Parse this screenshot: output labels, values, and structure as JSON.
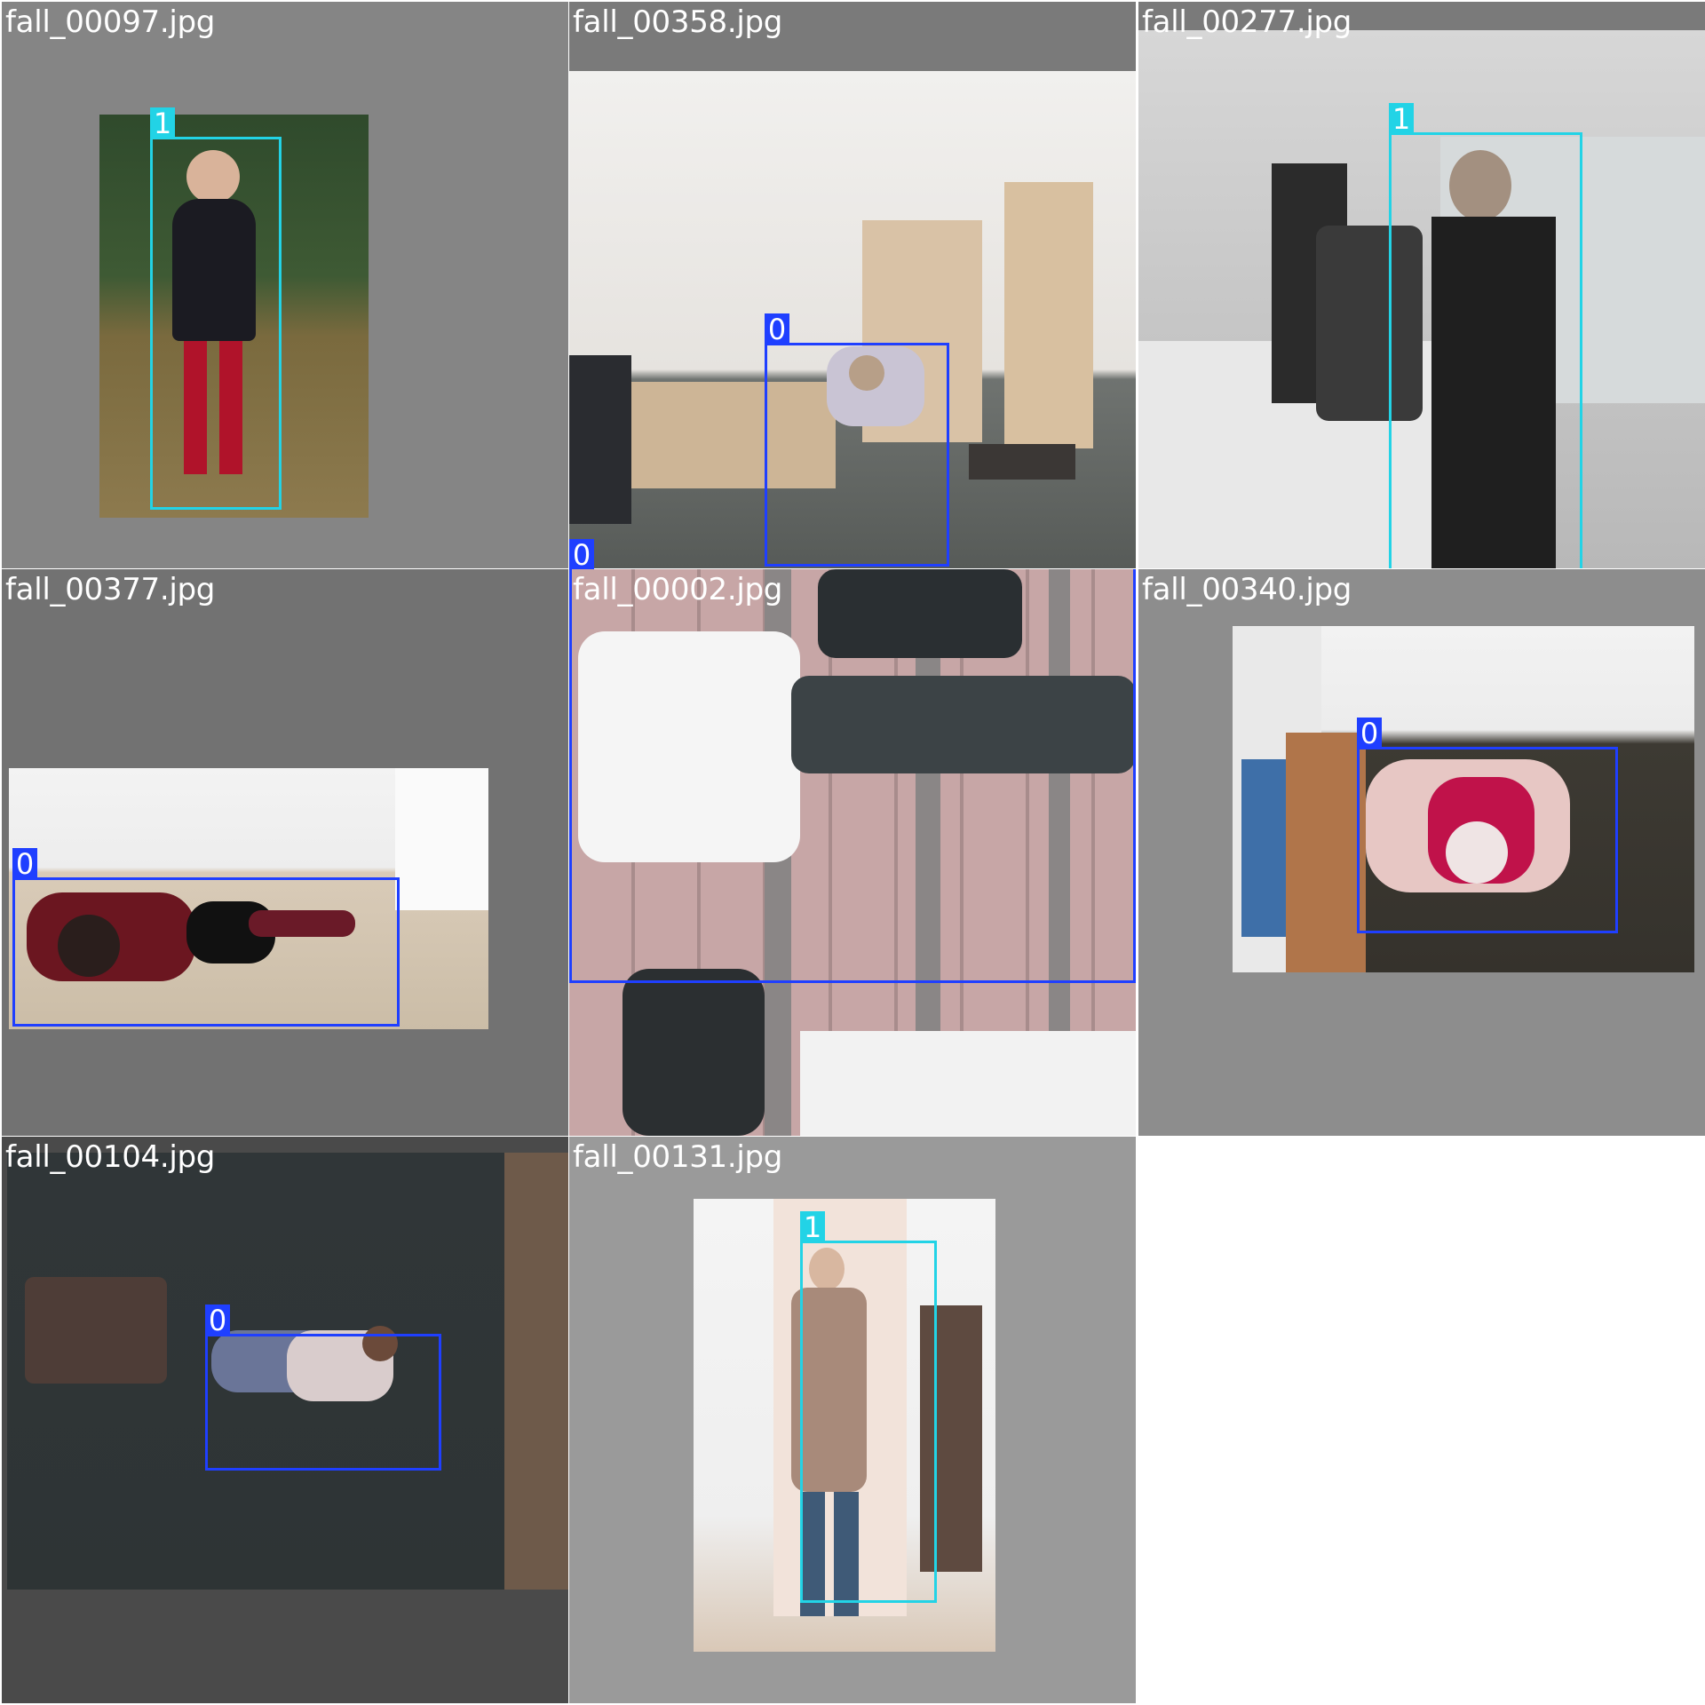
{
  "tiles": [
    {
      "filename": "fall_00097.jpg",
      "boxes": [
        {
          "cls": "1"
        }
      ]
    },
    {
      "filename": "fall_00358.jpg",
      "boxes": [
        {
          "cls": "0"
        },
        {
          "cls": "0"
        }
      ]
    },
    {
      "filename": "fall_00277.jpg",
      "boxes": [
        {
          "cls": "1"
        }
      ]
    },
    {
      "filename": "fall_00377.jpg",
      "boxes": [
        {
          "cls": "0"
        }
      ]
    },
    {
      "filename": "fall_00002.jpg",
      "boxes": [
        {
          "cls": "0"
        }
      ]
    },
    {
      "filename": "fall_00340.jpg",
      "boxes": [
        {
          "cls": "0"
        }
      ]
    },
    {
      "filename": "fall_00104.jpg",
      "boxes": [
        {
          "cls": "0"
        }
      ]
    },
    {
      "filename": "fall_00131.jpg",
      "boxes": [
        {
          "cls": "1"
        }
      ]
    }
  ],
  "colors": {
    "class_0": "#1f3fff",
    "class_1": "#22d3e6",
    "letterbox": "#808080"
  }
}
